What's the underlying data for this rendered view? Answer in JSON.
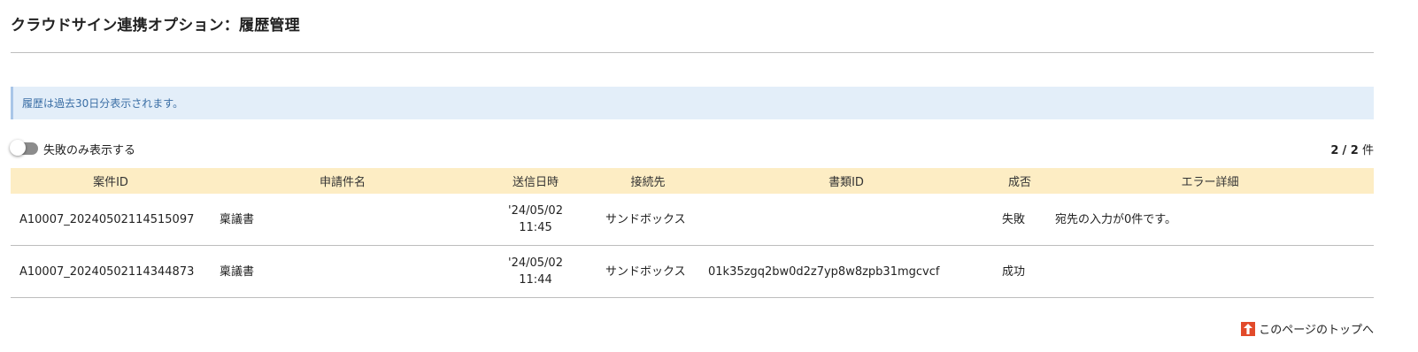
{
  "header": {
    "title": "クラウドサイン連携オプション：履歴管理"
  },
  "notice": {
    "text": "履歴は過去30日分表示されます。"
  },
  "filter": {
    "toggle_label": "失敗のみ表示する",
    "toggle_on": false
  },
  "count": {
    "current": "2",
    "total": "2",
    "unit": "件",
    "separator": "/"
  },
  "table": {
    "columns": [
      "案件ID",
      "申請件名",
      "送信日時",
      "接続先",
      "書類ID",
      "成否",
      "エラー詳細"
    ],
    "rows": [
      {
        "case_id": "A10007_20240502114515097",
        "subject": "稟議書",
        "date": "'24/05/02",
        "time": "11:45",
        "destination": "サンドボックス",
        "document_id": "",
        "result": "失敗",
        "error": "宛先の入力が0件です。"
      },
      {
        "case_id": "A10007_20240502114344873",
        "subject": "稟議書",
        "date": "'24/05/02",
        "time": "11:44",
        "destination": "サンドボックス",
        "document_id": "01k35zgq2bw0d2z7yp8w8zpb31mgcvcf",
        "result": "成功",
        "error": ""
      }
    ]
  },
  "footer": {
    "to_top_label": "このページのトップへ",
    "to_top_icon": "arrow-up-icon"
  },
  "colors": {
    "info_bg": "#e3eef9",
    "info_text": "#3a6ea5",
    "header_bg": "#fdedc4",
    "fail_text": "#e0201f",
    "to_top_icon_bg": "#e24a2a"
  }
}
